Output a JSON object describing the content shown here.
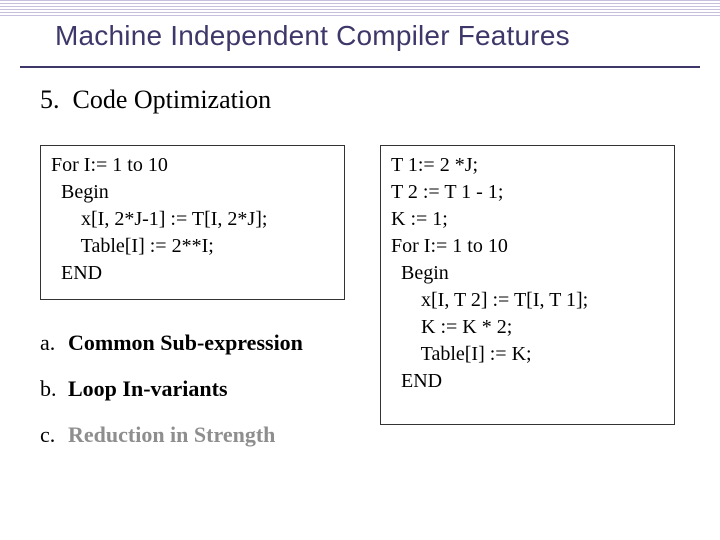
{
  "title": "Machine Independent Compiler Features",
  "section_number": "5.",
  "section_title": "Code Optimization",
  "code_left": {
    "l1": "For I:= 1 to 10",
    "l2": "  Begin",
    "l3": "      x[I, 2*J-1] := T[I, 2*J];",
    "l4": "      Table[I] := 2**I;",
    "l5": "  END"
  },
  "code_right": {
    "l1": "T 1:= 2 *J;",
    "l2": "T 2 := T 1 - 1;",
    "l3": "K := 1;",
    "l4": "For I:= 1 to 10",
    "l5": "  Begin",
    "l6": "      x[I, T 2] := T[I, T 1];",
    "l7": "      K := K * 2;",
    "l8": "      Table[I] := K;",
    "l9": "  END"
  },
  "bullets": {
    "a_letter": "a.",
    "a_text": "Common Sub-expression",
    "b_letter": "b.",
    "b_text": "Loop In-variants",
    "c_letter": "c.",
    "c_text": "Reduction in Strength"
  }
}
